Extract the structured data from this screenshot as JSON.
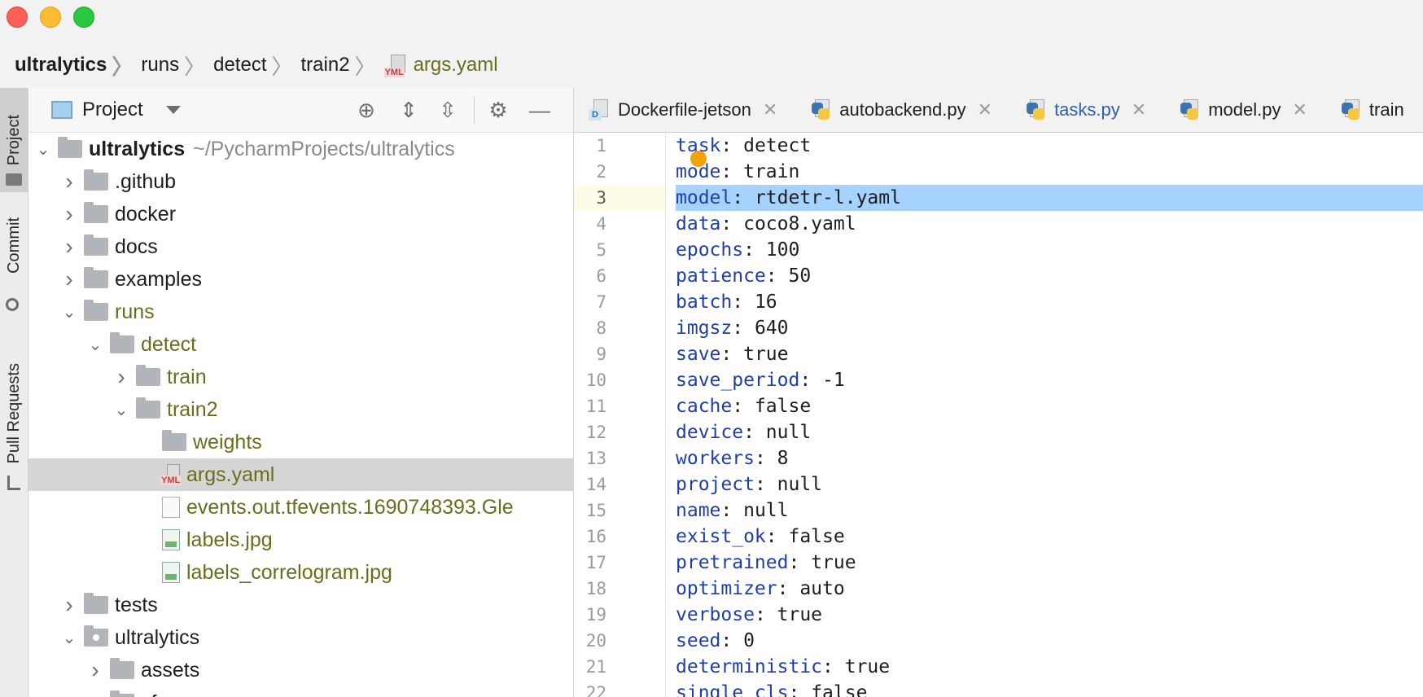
{
  "breadcrumb": [
    {
      "label": "ultralytics",
      "kind": "first"
    },
    {
      "label": "runs",
      "kind": "dir"
    },
    {
      "label": "detect",
      "kind": "dir"
    },
    {
      "label": "train2",
      "kind": "dir"
    },
    {
      "label": "args.yaml",
      "kind": "file",
      "icon": "yml-file-icon"
    }
  ],
  "strip": {
    "project": "Project",
    "commit": "Commit",
    "pull_requests": "Pull Requests"
  },
  "panel": {
    "title": "Project"
  },
  "tree": [
    {
      "depth": 0,
      "chev": "down",
      "icon": "folder",
      "label": "ultralytics",
      "label_style": "bold",
      "suffix": "~/PycharmProjects/ultralytics"
    },
    {
      "depth": 1,
      "chev": "right",
      "icon": "folder",
      "label": ".github"
    },
    {
      "depth": 1,
      "chev": "right",
      "icon": "folder",
      "label": "docker"
    },
    {
      "depth": 1,
      "chev": "right",
      "icon": "folder",
      "label": "docs"
    },
    {
      "depth": 1,
      "chev": "right",
      "icon": "folder",
      "label": "examples"
    },
    {
      "depth": 1,
      "chev": "down",
      "icon": "folder",
      "label": "runs",
      "label_style": "olive"
    },
    {
      "depth": 2,
      "chev": "down",
      "icon": "folder",
      "label": "detect",
      "label_style": "olive"
    },
    {
      "depth": 3,
      "chev": "right",
      "icon": "folder",
      "label": "train",
      "label_style": "olive"
    },
    {
      "depth": 3,
      "chev": "down",
      "icon": "folder",
      "label": "train2",
      "label_style": "olive"
    },
    {
      "depth": 4,
      "chev": "",
      "icon": "folder",
      "label": "weights",
      "label_style": "olive"
    },
    {
      "depth": 4,
      "chev": "",
      "icon": "yml",
      "label": "args.yaml",
      "label_style": "olive",
      "selected": true
    },
    {
      "depth": 4,
      "chev": "",
      "icon": "plain",
      "label": "events.out.tfevents.1690748393.Gle",
      "label_style": "olive"
    },
    {
      "depth": 4,
      "chev": "",
      "icon": "img",
      "label": "labels.jpg",
      "label_style": "olive"
    },
    {
      "depth": 4,
      "chev": "",
      "icon": "img",
      "label": "labels_correlogram.jpg",
      "label_style": "olive"
    },
    {
      "depth": 1,
      "chev": "right",
      "icon": "folder",
      "label": "tests"
    },
    {
      "depth": 1,
      "chev": "down",
      "icon": "package",
      "label": "ultralytics"
    },
    {
      "depth": 2,
      "chev": "right",
      "icon": "folder",
      "label": "assets"
    },
    {
      "depth": 2,
      "chev": "right",
      "icon": "folder",
      "label": "cfg"
    }
  ],
  "tabs": [
    {
      "label": "Dockerfile-jetson",
      "icon": "docker-file-icon",
      "active": false
    },
    {
      "label": "autobackend.py",
      "icon": "python-file-icon",
      "active": false
    },
    {
      "label": "tasks.py",
      "icon": "python-file-icon",
      "active": true
    },
    {
      "label": "model.py",
      "icon": "python-file-icon",
      "active": false
    },
    {
      "label": "train",
      "icon": "python-file-icon",
      "active": false
    }
  ],
  "code": [
    {
      "n": "1",
      "key": "task",
      "val": "detect"
    },
    {
      "n": "2",
      "key": "mode",
      "val": "train"
    },
    {
      "n": "3",
      "key": "model",
      "val": "rtdetr-l.yaml",
      "current": true
    },
    {
      "n": "4",
      "key": "data",
      "val": "coco8.yaml"
    },
    {
      "n": "5",
      "key": "epochs",
      "val": "100"
    },
    {
      "n": "6",
      "key": "patience",
      "val": "50"
    },
    {
      "n": "7",
      "key": "batch",
      "val": "16"
    },
    {
      "n": "8",
      "key": "imgsz",
      "val": "640"
    },
    {
      "n": "9",
      "key": "save",
      "val": "true"
    },
    {
      "n": "10",
      "key": "save_period",
      "val": "-1"
    },
    {
      "n": "11",
      "key": "cache",
      "val": "false"
    },
    {
      "n": "12",
      "key": "device",
      "val": "null"
    },
    {
      "n": "13",
      "key": "workers",
      "val": "8"
    },
    {
      "n": "14",
      "key": "project",
      "val": "null"
    },
    {
      "n": "15",
      "key": "name",
      "val": "null"
    },
    {
      "n": "16",
      "key": "exist_ok",
      "val": "false"
    },
    {
      "n": "17",
      "key": "pretrained",
      "val": "true"
    },
    {
      "n": "18",
      "key": "optimizer",
      "val": "auto"
    },
    {
      "n": "19",
      "key": "verbose",
      "val": "true"
    },
    {
      "n": "20",
      "key": "seed",
      "val": "0"
    },
    {
      "n": "21",
      "key": "deterministic",
      "val": "true"
    },
    {
      "n": "22",
      "key": "single_cls",
      "val": "false"
    }
  ],
  "colors": {
    "keyword": "#1f3fa8",
    "selection": "#a6d2ff",
    "olive": "#6c6c1e",
    "active_tab": "#2d5fb0"
  }
}
